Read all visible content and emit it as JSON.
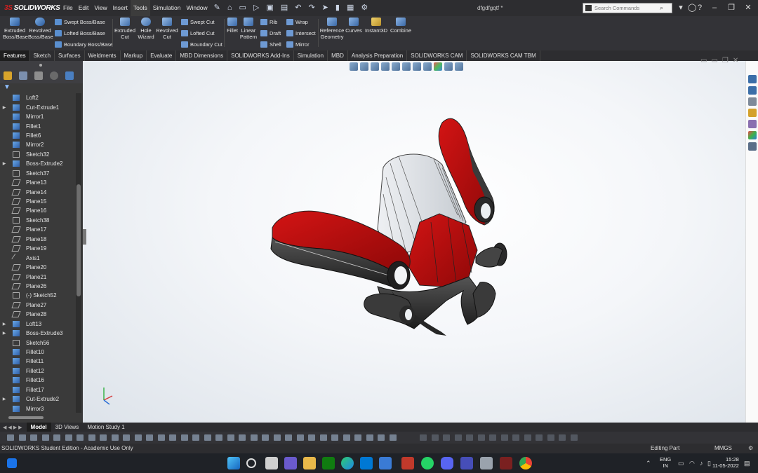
{
  "app": {
    "brand_prefix": "3S",
    "brand": "SOLIDWORKS",
    "document_title": "dfgdfgqtf *"
  },
  "menu": [
    "File",
    "Edit",
    "View",
    "Insert",
    "Tools",
    "Simulation",
    "Window"
  ],
  "search": {
    "placeholder": "Search Commands"
  },
  "command_manager": {
    "extruded_boss": "Extruded Boss/Base",
    "revolved_boss": "Revolved Boss/Base",
    "swept_boss": "Swept Boss/Base",
    "lofted_boss": "Lofted Boss/Base",
    "boundary_boss": "Boundary Boss/Base",
    "extruded_cut": "Extruded Cut",
    "hole_wizard": "Hole Wizard",
    "revolved_cut": "Revolved Cut",
    "swept_cut": "Swept Cut",
    "lofted_cut": "Lofted Cut",
    "boundary_cut": "Boundary Cut",
    "fillet": "Fillet",
    "linear_pattern": "Linear Pattern",
    "rib": "Rib",
    "draft": "Draft",
    "shell": "Shell",
    "wrap": "Wrap",
    "intersect": "Intersect",
    "mirror": "Mirror",
    "reference_geometry": "Reference Geometry",
    "curves": "Curves",
    "instant3d": "Instant3D",
    "combine": "Combine"
  },
  "tabs": [
    "Features",
    "Sketch",
    "Surfaces",
    "Weldments",
    "Markup",
    "Evaluate",
    "MBD Dimensions",
    "SOLIDWORKS Add-Ins",
    "Simulation",
    "MBD",
    "Analysis Preparation",
    "SOLIDWORKS CAM",
    "SOLIDWORKS CAM TBM"
  ],
  "feature_tree": [
    {
      "label": "Loft2",
      "icon": "feature",
      "expand": false
    },
    {
      "label": "Cut-Extrude1",
      "icon": "feature",
      "expand": true
    },
    {
      "label": "Mirror1",
      "icon": "feature",
      "expand": false
    },
    {
      "label": "Fillet1",
      "icon": "feature",
      "expand": false
    },
    {
      "label": "Fillet6",
      "icon": "feature",
      "expand": false
    },
    {
      "label": "Mirror2",
      "icon": "feature",
      "expand": false
    },
    {
      "label": "Sketch32",
      "icon": "sketch",
      "expand": false
    },
    {
      "label": "Boss-Extrude2",
      "icon": "feature",
      "expand": true
    },
    {
      "label": "Sketch37",
      "icon": "sketch",
      "expand": false
    },
    {
      "label": "Plane13",
      "icon": "plane",
      "expand": false
    },
    {
      "label": "Plane14",
      "icon": "plane",
      "expand": false
    },
    {
      "label": "Plane15",
      "icon": "plane",
      "expand": false
    },
    {
      "label": "Plane16",
      "icon": "plane",
      "expand": false
    },
    {
      "label": "Sketch38",
      "icon": "sketch",
      "expand": false
    },
    {
      "label": "Plane17",
      "icon": "plane",
      "expand": false
    },
    {
      "label": "Plane18",
      "icon": "plane",
      "expand": false
    },
    {
      "label": "Plane19",
      "icon": "plane",
      "expand": false
    },
    {
      "label": "Axis1",
      "icon": "axis",
      "expand": false
    },
    {
      "label": "Plane20",
      "icon": "plane",
      "expand": false
    },
    {
      "label": "Plane21",
      "icon": "plane",
      "expand": false
    },
    {
      "label": "Plane26",
      "icon": "plane",
      "expand": false
    },
    {
      "label": "(-) Sketch52",
      "icon": "sketch",
      "expand": false
    },
    {
      "label": "Plane27",
      "icon": "plane",
      "expand": false
    },
    {
      "label": "Plane28",
      "icon": "plane",
      "expand": false
    },
    {
      "label": "Loft13",
      "icon": "feature",
      "expand": true
    },
    {
      "label": "Boss-Extrude3",
      "icon": "feature",
      "expand": true
    },
    {
      "label": "Sketch56",
      "icon": "sketch",
      "expand": false
    },
    {
      "label": "Fillet10",
      "icon": "feature",
      "expand": false
    },
    {
      "label": "Fillet11",
      "icon": "feature",
      "expand": false
    },
    {
      "label": "Fillet12",
      "icon": "feature",
      "expand": false
    },
    {
      "label": "Fillet16",
      "icon": "feature",
      "expand": false
    },
    {
      "label": "Fillet17",
      "icon": "feature",
      "expand": false
    },
    {
      "label": "Cut-Extrude2",
      "icon": "feature",
      "expand": true
    },
    {
      "label": "Mirror3",
      "icon": "feature",
      "expand": false
    }
  ],
  "bottom_tabs": [
    "Model",
    "3D Views",
    "Motion Study 1"
  ],
  "status": {
    "left": "SOLIDWORKS Student Edition - Academic Use Only",
    "mode": "Editing Part",
    "units": "MMGS"
  },
  "taskbar": {
    "lang_top": "ENG",
    "lang_bottom": "IN",
    "time": "15:28",
    "date": "11-05-2022"
  },
  "colors": {
    "model_red": "#b80d0d",
    "model_black": "#2a2a2a",
    "model_glass": "#d9dde2",
    "ui_dark": "#2d2d30"
  }
}
